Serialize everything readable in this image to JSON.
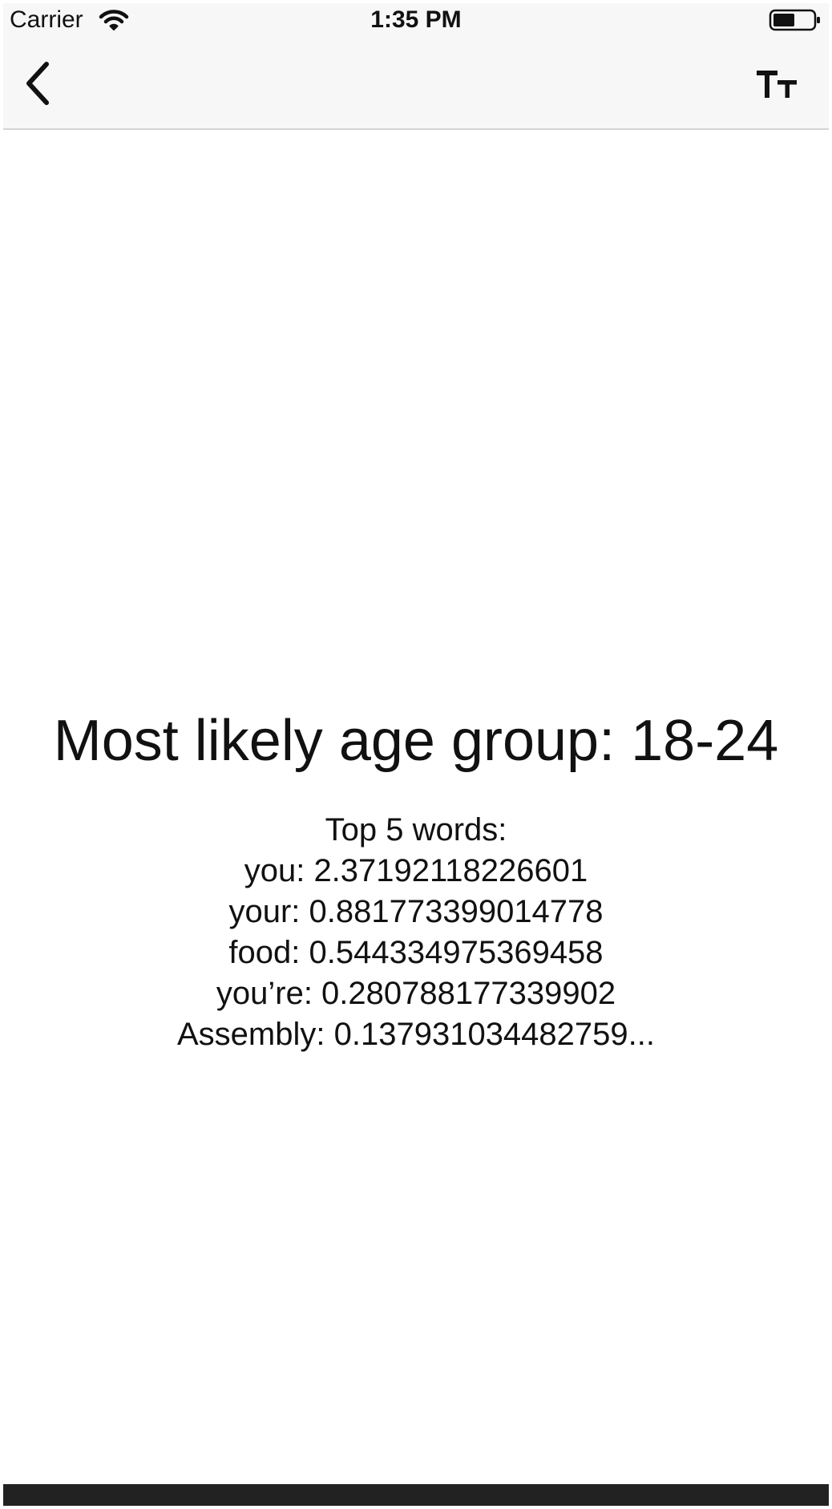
{
  "status_bar": {
    "carrier": "Carrier",
    "time": "1:35 PM",
    "wifi_icon": "wifi-icon",
    "battery_icon": "battery-icon"
  },
  "nav_bar": {
    "back_icon": "chevron-left-icon",
    "text_size_icon": "text-size-icon",
    "text_size_glyph": "TT"
  },
  "result": {
    "title": "Most likely age group: 18-24",
    "words_heading": "Top 5 words:",
    "words": [
      "you: 2.37192118226601",
      "your: 0.881773399014778",
      "food: 0.544334975369458",
      "you’re: 0.280788177339902",
      "Assembly: 0.137931034482759..."
    ]
  },
  "colors": {
    "bar_background": "#f7f7f7",
    "text": "#111111",
    "bottom_bar": "#222222"
  }
}
